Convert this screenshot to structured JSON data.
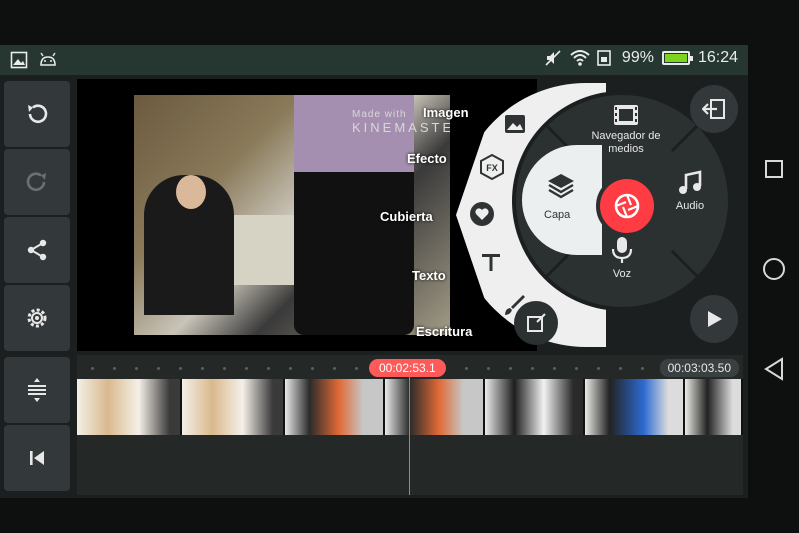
{
  "status_bar": {
    "battery_text": "99%",
    "battery_level": 0.99,
    "time": "16:24"
  },
  "arc_menu": {
    "items": [
      {
        "label": "Imagen",
        "icon": "image-icon"
      },
      {
        "label": "Efecto",
        "icon": "fx-icon"
      },
      {
        "label": "Cubierta",
        "icon": "sticker-icon"
      },
      {
        "label": "Texto",
        "icon": "text-icon"
      },
      {
        "label": "Escritura",
        "icon": "brush-icon"
      }
    ]
  },
  "wheel": {
    "top": "Navegador de medios",
    "right": "Audio",
    "bottom": "Voz",
    "left": "Capa"
  },
  "watermark": {
    "prefix": "Made with",
    "brand": "KINEMASTER"
  },
  "timeline": {
    "current_time": "00:02:53.1",
    "duration": "00:03:03.50"
  },
  "colors": {
    "accent": "#ff3b44",
    "panel": "#33383a",
    "status_bar": "#263631"
  }
}
